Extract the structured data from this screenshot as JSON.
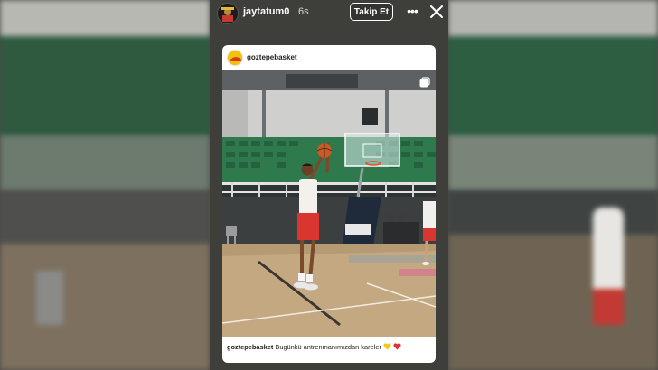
{
  "story_header": {
    "username": "jaytatum0",
    "time": "6s",
    "follow_label": "Takip Et",
    "more_icon": "more-dots-icon",
    "close_icon": "close-icon"
  },
  "post": {
    "username": "goztepebasket",
    "caption_user": "goztepebasket",
    "caption_text": "Bugünkü antrenmanımızdan kareler",
    "emojis": [
      "yellow-heart-icon",
      "red-heart-icon"
    ],
    "carousel_icon": "carousel-icon"
  },
  "colors": {
    "backdrop": "#4a4a46",
    "card": "#ffffff",
    "heart_yellow": "#f5c518",
    "heart_red": "#e0303a",
    "jersey_red": "#d8362e",
    "gym_seats": "#2f7a4c",
    "court_floor": "#c4a882"
  }
}
